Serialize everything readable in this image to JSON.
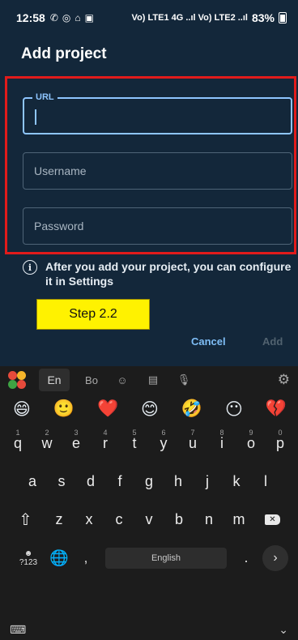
{
  "status_bar": {
    "time": "12:58",
    "notif_icons": [
      "whatsapp-icon",
      "instagram-icon",
      "lock-icon",
      "gallery-icon"
    ],
    "network_text": "Vo) LTE1 4G ..ıl Vo) LTE2 ..ıl",
    "battery": "83%"
  },
  "header": {
    "title": "Add project"
  },
  "form": {
    "url_label": "URL",
    "username_placeholder": "Username",
    "password_placeholder": "Password"
  },
  "info": {
    "text": "After you add your project, you can configure it in Settings"
  },
  "annotation": {
    "step_label": "Step 2.2"
  },
  "dialog_buttons": {
    "cancel": "Cancel",
    "add": "Add"
  },
  "keyboard": {
    "lang": "En",
    "emojis": [
      "😄",
      "🙂",
      "❤️",
      "😊",
      "🤣",
      "😶",
      "💔"
    ],
    "row1": [
      {
        "k": "q",
        "n": "1"
      },
      {
        "k": "w",
        "n": "2"
      },
      {
        "k": "e",
        "n": "3"
      },
      {
        "k": "r",
        "n": "4"
      },
      {
        "k": "t",
        "n": "5"
      },
      {
        "k": "y",
        "n": "6"
      },
      {
        "k": "u",
        "n": "7"
      },
      {
        "k": "i",
        "n": "8"
      },
      {
        "k": "o",
        "n": "9"
      },
      {
        "k": "p",
        "n": "0"
      }
    ],
    "row2": [
      "a",
      "s",
      "d",
      "f",
      "g",
      "h",
      "j",
      "k",
      "l"
    ],
    "row3": [
      "z",
      "x",
      "c",
      "v",
      "b",
      "n",
      "m"
    ],
    "sym_label": "?123",
    "sym_top": "☻",
    "space_label": "English",
    "comma": ",",
    "period": "."
  },
  "colors": {
    "accent": "#8ec5ff",
    "highlight": "#e11b1b",
    "step_bg": "#fff200"
  }
}
